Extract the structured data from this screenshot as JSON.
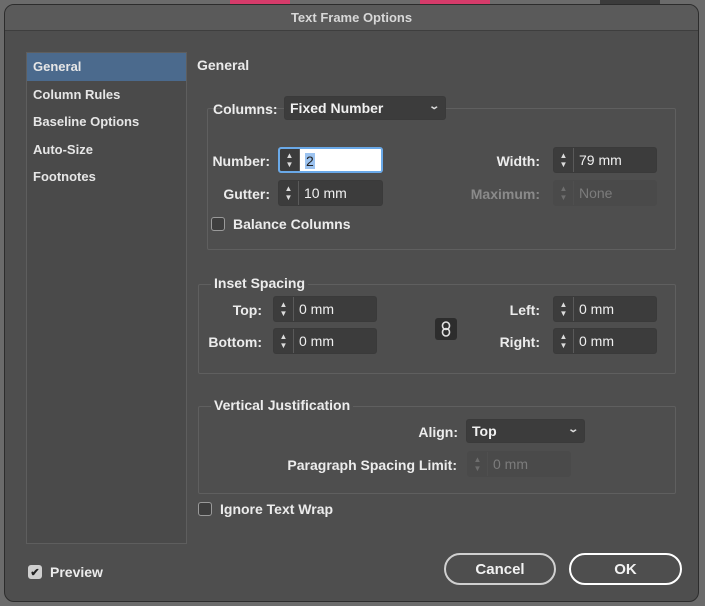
{
  "window": {
    "title": "Text Frame Options"
  },
  "sidebar": {
    "items": [
      {
        "label": "General",
        "active": true
      },
      {
        "label": "Column Rules"
      },
      {
        "label": "Baseline Options"
      },
      {
        "label": "Auto-Size"
      },
      {
        "label": "Footnotes"
      }
    ]
  },
  "main": {
    "title": "General",
    "columns": {
      "label": "Columns:",
      "mode": "Fixed Number",
      "number_label": "Number:",
      "number_value": "2",
      "gutter_label": "Gutter:",
      "gutter_value": "10 mm",
      "width_label": "Width:",
      "width_value": "79 mm",
      "maximum_label": "Maximum:",
      "maximum_value": "None",
      "balance_label": "Balance Columns",
      "balance_checked": false
    },
    "inset": {
      "label": "Inset Spacing",
      "top_label": "Top:",
      "top_value": "0 mm",
      "bottom_label": "Bottom:",
      "bottom_value": "0 mm",
      "left_label": "Left:",
      "left_value": "0 mm",
      "right_label": "Right:",
      "right_value": "0 mm"
    },
    "vertical": {
      "label": "Vertical Justification",
      "align_label": "Align:",
      "align_value": "Top",
      "spacing_label": "Paragraph Spacing Limit:",
      "spacing_value": "0 mm"
    },
    "ignore_wrap_label": "Ignore Text Wrap",
    "ignore_wrap_checked": false
  },
  "footer": {
    "preview_label": "Preview",
    "preview_checked": true,
    "cancel_label": "Cancel",
    "ok_label": "OK"
  },
  "colors": {
    "accent": "#4b6a8d",
    "focus": "#6aa9e8"
  },
  "icons": [
    "chevron-down-icon",
    "stepper-arrows-icon",
    "chain-link-icon",
    "checkmark-icon"
  ]
}
